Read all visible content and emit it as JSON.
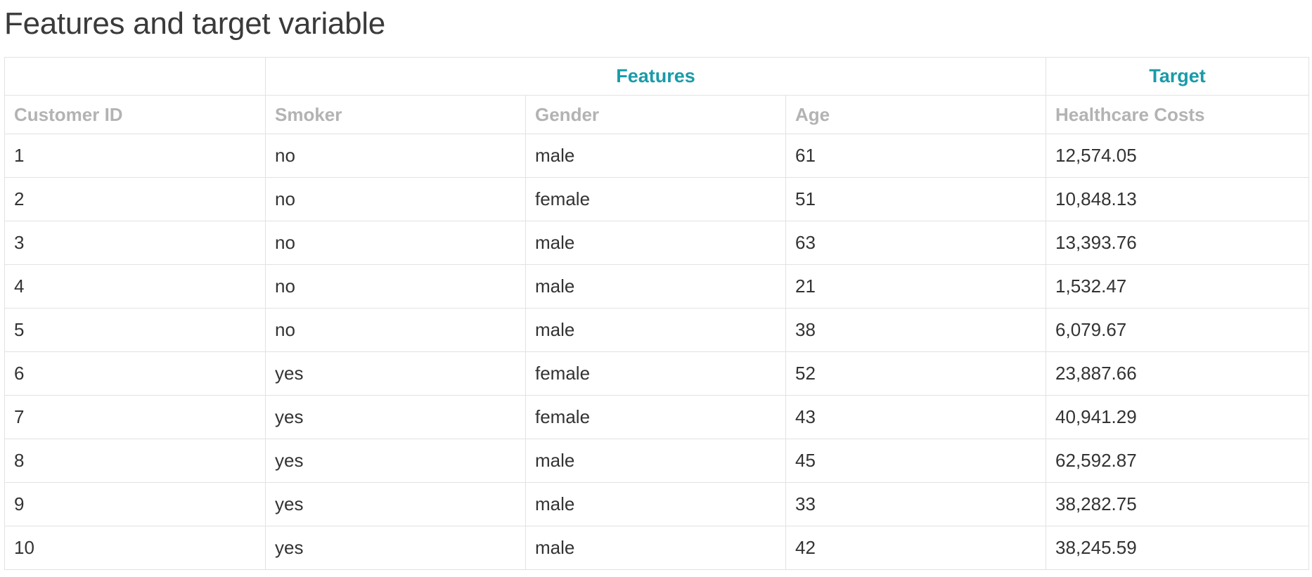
{
  "page": {
    "title": "Features and target variable"
  },
  "table": {
    "groups": {
      "features": "Features",
      "target": "Target"
    },
    "columns": [
      "Customer ID",
      "Smoker",
      "Gender",
      "Age",
      "Healthcare Costs"
    ],
    "rows": [
      [
        "1",
        "no",
        "male",
        "61",
        "12,574.05"
      ],
      [
        "2",
        "no",
        "female",
        "51",
        "10,848.13"
      ],
      [
        "3",
        "no",
        "male",
        "63",
        "13,393.76"
      ],
      [
        "4",
        "no",
        "male",
        "21",
        "1,532.47"
      ],
      [
        "5",
        "no",
        "male",
        "38",
        "6,079.67"
      ],
      [
        "6",
        "yes",
        "female",
        "52",
        "23,887.66"
      ],
      [
        "7",
        "yes",
        "female",
        "43",
        "40,941.29"
      ],
      [
        "8",
        "yes",
        "male",
        "45",
        "62,592.87"
      ],
      [
        "9",
        "yes",
        "male",
        "33",
        "38,282.75"
      ],
      [
        "10",
        "yes",
        "male",
        "42",
        "38,245.59"
      ]
    ]
  },
  "colors": {
    "group_header": "#1a9ba8",
    "column_header": "#b3b3b3",
    "cell_text": "#333333",
    "border": "#e2e2e2"
  }
}
